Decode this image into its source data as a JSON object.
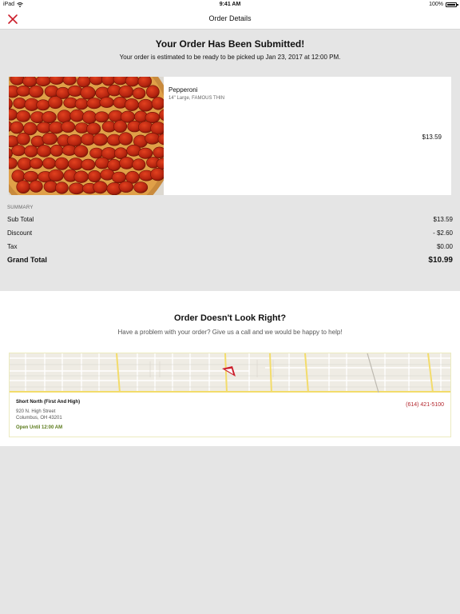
{
  "status_bar": {
    "carrier": "iPad",
    "time": "9:41 AM",
    "battery": "100%",
    "battery_level": 1.0
  },
  "nav": {
    "title": "Order Details",
    "close_icon": "close-x-icon",
    "accent": "#cc1e2b"
  },
  "order": {
    "headline": "Your Order Has Been Submitted!",
    "estimate": "Your order is estimated to be ready to be picked up Jan 23, 2017 at 12:00 PM."
  },
  "item": {
    "name": "Pepperoni",
    "description": "14\" Large, FAMOUS THIN",
    "price": "$13.59"
  },
  "summary": {
    "label": "SUMMARY",
    "rows": [
      {
        "label": "Sub Total",
        "value": "$13.59"
      },
      {
        "label": "Discount",
        "value": "- $2.60"
      },
      {
        "label": "Tax",
        "value": "$0.00"
      },
      {
        "label": "Grand Total",
        "value": "$10.99"
      }
    ]
  },
  "help": {
    "title": "Order Doesn't Look Right?",
    "subtitle": "Have a problem with your order? Give us a call and we would be happy to help!"
  },
  "store": {
    "name": "Short North (First And High)",
    "address_line1": "920 N. High Street",
    "address_line2": "Columbus, OH 43201",
    "hours": "Open Until 12:00 AM",
    "phone": "(614) 421-5100",
    "phone_color": "#b3262d",
    "hours_color": "#5a7a1a"
  }
}
